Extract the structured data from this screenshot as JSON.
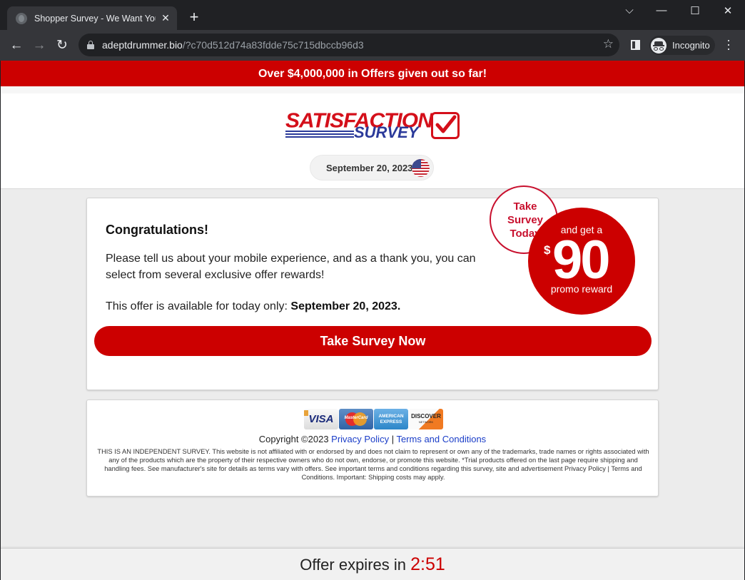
{
  "browser": {
    "tab": {
      "title": "Shopper Survey - We Want Your",
      "favicon": "globe-icon"
    },
    "new_tab_label": "+",
    "window_controls": {
      "dropdown": "⌵",
      "minimize": "—",
      "maximize": "☐",
      "close": "✕"
    },
    "nav": {
      "back": "←",
      "forward": "→",
      "reload": "↻"
    },
    "url_domain": "adeptdrummer.bio",
    "url_path": "/?c70d512d74a83fdde75c715dbccb96d3",
    "star_icon": "☆",
    "incognito_label": "Incognito",
    "menu_icon": "⋮"
  },
  "page": {
    "top_banner": "Over $4,000,000 in Offers given out so far!",
    "logo": {
      "line1": "SATISFACTION",
      "line2": "SURVEY"
    },
    "date": "September 20, 2023",
    "card": {
      "heading": "Congratulations!",
      "message": "Please tell us about your mobile experience, and as a thank you, you can select from several exclusive offer rewards!",
      "availability_prefix": "This offer is available for today only: ",
      "availability_date": "September 20, 2023.",
      "cta_label": "Take Survey Now"
    },
    "badge_small": {
      "line1": "Take",
      "line2": "Survey",
      "line3": "Today"
    },
    "badge_big": {
      "top": "and get a",
      "currency": "$",
      "amount": "90",
      "bottom": "promo reward"
    },
    "footer": {
      "payment_cards": [
        "VISA",
        "MasterCard",
        "AMERICAN EXPRESS",
        "DISCOVER"
      ],
      "copyright": "Copyright ©2023 ",
      "privacy_link": "Privacy Policy",
      "separator": " | ",
      "terms_link": "Terms and Conditions",
      "disclaimer": "THIS IS AN INDEPENDENT SURVEY. This website is not affiliated with or endorsed by and does not claim to represent or own any of the trademarks, trade names or rights associated with any of the products which are the property of their respective owners who do not own, endorse, or promote this website. *Trial products offered on the last page require shipping and handling fees. See manufacturer's site for details as terms vary with offers. See important terms and conditions regarding this survey, site and advertisement Privacy Policy | Terms and Conditions. Important: Shipping costs may apply."
    },
    "expires": {
      "label": "Offer expires in ",
      "timer": "2:51"
    }
  },
  "colors": {
    "brand_red": "#cc0000",
    "logo_blue": "#2b3a9a",
    "link_blue": "#1a3dc8"
  }
}
